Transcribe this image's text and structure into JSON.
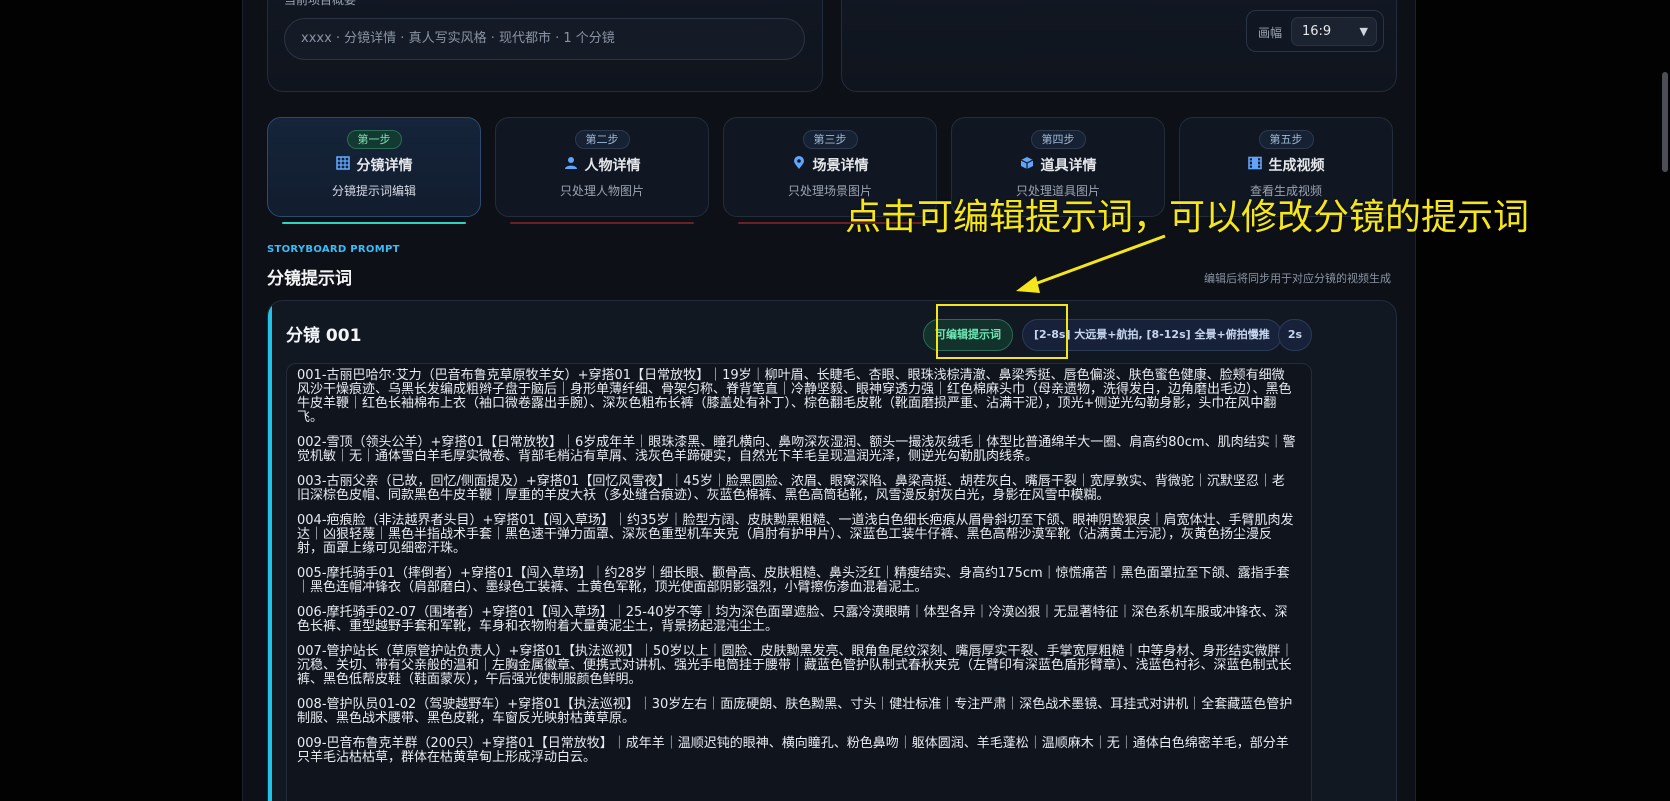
{
  "top": {
    "label": "当前项目概要",
    "summary_placeholder": "xxxx · 分镜详情 · 真人写实风格 · 现代都市 · 1 个分镜",
    "ratio_label": "画幅",
    "ratio_value": "16:9"
  },
  "steps": [
    {
      "badge": "第一步",
      "title": "分镜详情",
      "sub": "分镜提示词编辑",
      "icon": "grid-icon"
    },
    {
      "badge": "第二步",
      "title": "人物详情",
      "sub": "只处理人物图片",
      "icon": "user-icon"
    },
    {
      "badge": "第三步",
      "title": "场景详情",
      "sub": "只处理场景图片",
      "icon": "location-pin-icon"
    },
    {
      "badge": "第四步",
      "title": "道具详情",
      "sub": "只处理道具图片",
      "icon": "cube-icon"
    },
    {
      "badge": "第五步",
      "title": "生成视频",
      "sub": "查看生成视频",
      "icon": "film-icon"
    }
  ],
  "section": {
    "kicker": "STORYBOARD PROMPT",
    "title": "分镜提示词",
    "hint": "编辑后将同步用于对应分镜的视频生成"
  },
  "shot": {
    "title": "分镜 001",
    "edit_label": "可编辑提示词",
    "shot_info": "[2-8s] 大远景+航拍, [8-12s] 全景+俯拍慢推",
    "duration": "2s",
    "prompt_lines": [
      "001-古丽巴哈尔·艾力（巴音布鲁克草原牧羊女）+穿搭01【日常放牧】｜19岁｜柳叶眉、长睫毛、杏眼、眼珠浅棕清澈、鼻梁秀挺、唇色偏淡、肤色蜜色健康、脸颊有细微风沙干燥痕迹、乌黑长发编成粗辫子盘于脑后｜身形单薄纤细、骨架匀称、脊背笔直｜冷静坚毅、眼神穿透力强｜红色棉麻头巾（母亲遗物，洗得发白，边角磨出毛边）、黑色牛皮羊鞭｜红色长袖棉布上衣（袖口微卷露出手腕）、深灰色粗布长裤（膝盖处有补丁）、棕色翻毛皮靴（靴面磨损严重、沾满干泥），顶光+侧逆光勾勒身影，头巾在风中翻飞。",
      "002-雪顶（领头公羊）+穿搭01【日常放牧】｜6岁成年羊｜眼珠漆黑、瞳孔横向、鼻吻深灰湿润、额头一撮浅灰绒毛｜体型比普通绵羊大一圈、肩高约80cm、肌肉结实｜警觉机敏｜无｜通体雪白羊毛厚实微卷、背部毛梢沾有草屑、浅灰色羊蹄硬实，自然光下羊毛呈现温润光泽，侧逆光勾勒肌肉线条。",
      "003-古丽父亲（已故，回忆/侧面提及）+穿搭01【回忆风雪夜】｜45岁｜脸黑圆脸、浓眉、眼窝深陷、鼻梁高挺、胡茬灰白、嘴唇干裂｜宽厚敦实、背微驼｜沉默坚忍｜老旧深棕色皮帽、同款黑色牛皮羊鞭｜厚重的羊皮大袄（多处缝合痕迹）、灰蓝色棉裤、黑色高筒毡靴，风雪漫反射灰白光，身影在风雪中模糊。",
      "004-疤痕脸（非法越界者头目）+穿搭01【闯入草场】｜约35岁｜脸型方阔、皮肤黝黑粗糙、一道浅白色细长疤痕从眉骨斜切至下颌、眼神阴鸷狠戾｜肩宽体壮、手臂肌肉发达｜凶狠轻蔑｜黑色半指战术手套｜黑色速干弹力面罩、深灰色重型机车夹克（肩肘有护甲片）、深蓝色工装牛仔裤、黑色高帮沙漠军靴（沾满黄土污泥），灰黄色扬尘漫反射，面罩上缘可见细密汗珠。",
      "005-摩托骑手01（摔倒者）+穿搭01【闯入草场】｜约28岁｜细长眼、颧骨高、皮肤粗糙、鼻头泛红｜精瘦结实、身高约175cm｜惊慌痛苦｜黑色面罩拉至下颌、露指手套｜黑色连帽冲锋衣（肩部磨白）、墨绿色工装裤、土黄色军靴，顶光使面部阴影强烈，小臂擦伤渗血混着泥土。",
      "006-摩托骑手02-07（围堵者）+穿搭01【闯入草场】｜25-40岁不等｜均为深色面罩遮脸、只露冷漠眼睛｜体型各异｜冷漠凶狠｜无显著特征｜深色系机车服或冲锋衣、深色长裤、重型越野手套和军靴，车身和衣物附着大量黄泥尘土，背景扬起混沌尘土。",
      "007-管护站长（草原管护站负责人）+穿搭01【执法巡视】｜50岁以上｜圆脸、皮肤黝黑发亮、眼角鱼尾纹深刻、嘴唇厚实干裂、手掌宽厚粗糙｜中等身材、身形结实微胖｜沉稳、关切、带有父亲般的温和｜左胸金属徽章、便携式对讲机、强光手电筒挂于腰带｜藏蓝色管护队制式春秋夹克（左臂印有深蓝色盾形臂章）、浅蓝色衬衫、深蓝色制式长裤、黑色低帮皮鞋（鞋面蒙灰），午后强光使制服颜色鲜明。",
      "008-管护队员01-02（驾驶越野车）+穿搭01【执法巡视】｜30岁左右｜面庞硬朗、肤色黝黑、寸头｜健壮标准｜专注严肃｜深色战术墨镜、耳挂式对讲机｜全套藏蓝色管护制服、黑色战术腰带、黑色皮靴，车窗反光映射枯黄草原。",
      "009-巴音布鲁克羊群（200只）+穿搭01【日常放牧】｜成年羊｜温顺迟钝的眼神、横向瞳孔、粉色鼻吻｜躯体圆润、羊毛蓬松｜温顺麻木｜无｜通体白色绵密羊毛，部分羊只羊毛沾枯枯草，群体在枯黄草甸上形成浮动白云。"
    ]
  },
  "annotation": {
    "text": "点击可编辑提示词，可以修改分镜的提示词",
    "color": "#f5e61b"
  },
  "colors": {
    "accent": "#22c3e6",
    "active_tab_line": "#2dd4bf",
    "inactive_tab_line": "#7f1d1d",
    "edit_badge": "#6ee7b7"
  }
}
